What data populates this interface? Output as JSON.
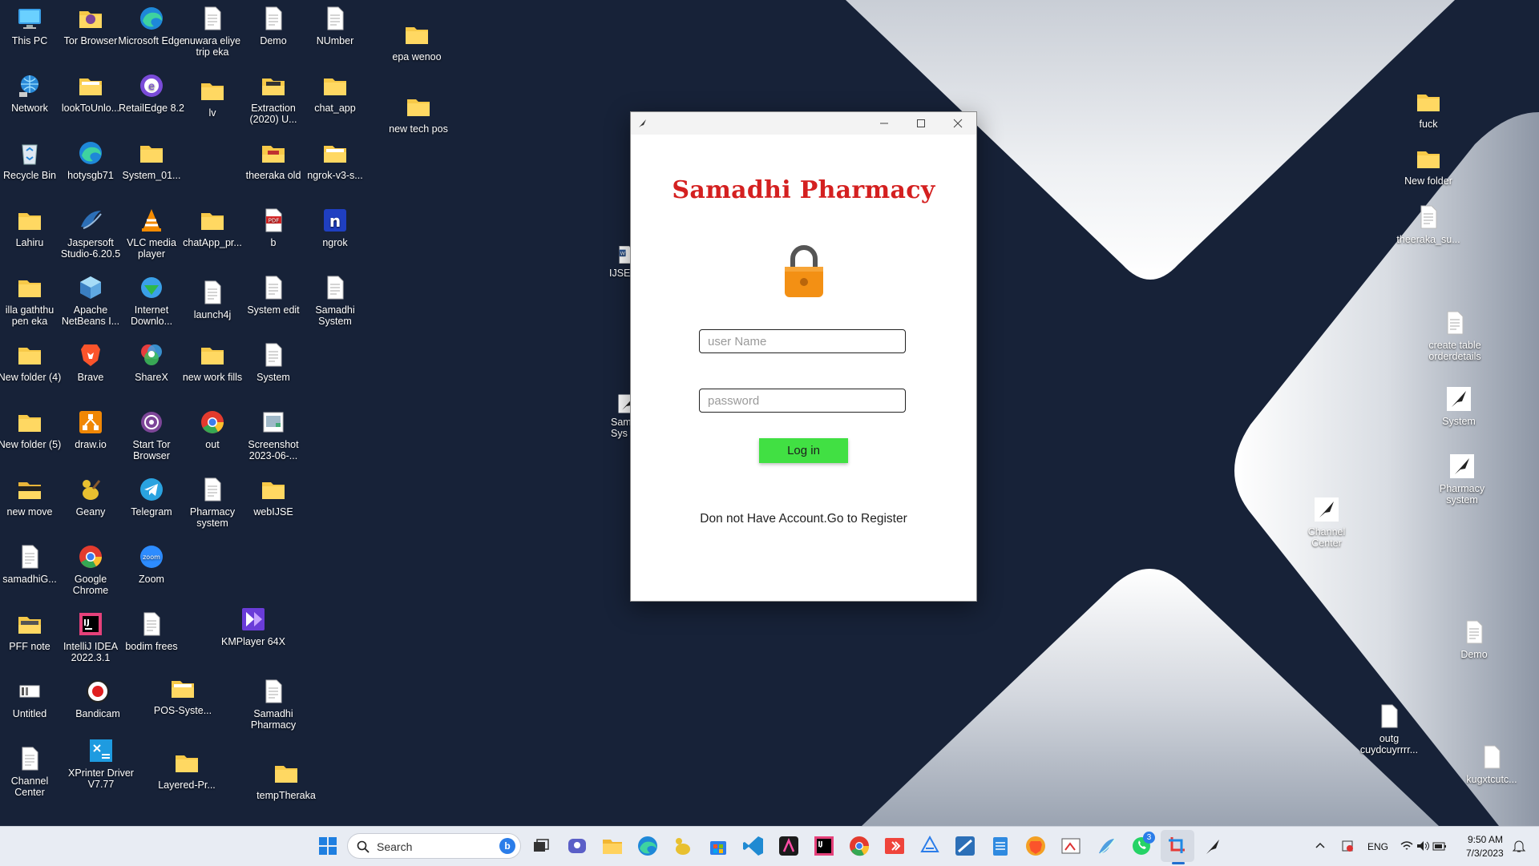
{
  "desktop": {
    "icons_col1": [
      {
        "label": "This PC",
        "icon": "computer-icon"
      },
      {
        "label": "Network",
        "icon": "network-icon"
      },
      {
        "label": "Recycle Bin",
        "icon": "recycle-bin-icon"
      },
      {
        "label": "Lahiru",
        "icon": "folder-icon"
      },
      {
        "label": "illa gaththu pen eka",
        "icon": "folder-icon"
      },
      {
        "label": "New folder (4)",
        "icon": "folder-icon"
      },
      {
        "label": "New folder (5)",
        "icon": "folder-icon"
      },
      {
        "label": "new move",
        "icon": "folder-icon"
      },
      {
        "label": "samadhiG...",
        "icon": "file-icon"
      },
      {
        "label": "PFF note",
        "icon": "folder-icon"
      },
      {
        "label": "Untitled",
        "icon": "image-icon"
      },
      {
        "label": "Channel Center",
        "icon": "file-icon"
      }
    ],
    "icons_col2": [
      {
        "label": "Tor Browser",
        "icon": "folder-icon"
      },
      {
        "label": "lookToUnlo...",
        "icon": "folder-icon"
      },
      {
        "label": "hotysgb71",
        "icon": "edge-icon"
      },
      {
        "label": "Jaspersoft Studio-6.20.5",
        "icon": "jaspersoft-icon"
      },
      {
        "label": "Apache NetBeans I...",
        "icon": "netbeans-icon"
      },
      {
        "label": "Brave",
        "icon": "brave-icon"
      },
      {
        "label": "draw.io",
        "icon": "drawio-icon"
      },
      {
        "label": "Geany",
        "icon": "geany-icon"
      },
      {
        "label": "Google Chrome",
        "icon": "chrome-icon"
      },
      {
        "label": "IntelliJ IDEA 2022.3.1",
        "icon": "intellij-icon"
      },
      {
        "label": "Bandicam",
        "icon": "bandicam-icon"
      },
      {
        "label": "XPrinter Driver V7.77",
        "icon": "xprinter-icon"
      }
    ],
    "icons_col3": [
      {
        "label": "Microsoft Edge",
        "icon": "edge-icon"
      },
      {
        "label": "RetailEdge 8.2",
        "icon": "retailedge-icon"
      },
      {
        "label": "System_01...",
        "icon": "folder-icon"
      },
      {
        "label": "VLC media player",
        "icon": "vlc-icon"
      },
      {
        "label": "Internet Downlo...",
        "icon": "idm-icon"
      },
      {
        "label": "ShareX",
        "icon": "sharex-icon"
      },
      {
        "label": "Start Tor Browser",
        "icon": "tor-icon"
      },
      {
        "label": "Telegram",
        "icon": "telegram-icon"
      },
      {
        "label": "Zoom",
        "icon": "zoom-icon"
      },
      {
        "label": "bodim frees",
        "icon": "file-icon"
      },
      {
        "label": "POS-Syste...",
        "icon": "folder-icon"
      },
      {
        "label": "Layered-Pr...",
        "icon": "folder-icon"
      }
    ],
    "icons_col4": [
      {
        "label": "nuwara eliye trip eka",
        "icon": "file-icon"
      },
      {
        "label": "lv",
        "icon": "folder-icon"
      },
      {
        "label": "chatApp_pr...",
        "icon": "folder-icon"
      },
      {
        "label": "launch4j",
        "icon": "file-icon"
      },
      {
        "label": "new work fills",
        "icon": "folder-icon"
      },
      {
        "label": "out",
        "icon": "chrome-icon"
      },
      {
        "label": "Pharmacy system",
        "icon": "file-icon"
      },
      {
        "label": "KMPlayer 64X",
        "icon": "kmplayer-icon"
      }
    ],
    "icons_col5": [
      {
        "label": "Demo",
        "icon": "file-icon"
      },
      {
        "label": "Extraction (2020) U...",
        "icon": "folder-icon"
      },
      {
        "label": "theeraka old",
        "icon": "folder-icon"
      },
      {
        "label": "b",
        "icon": "pdf-icon"
      },
      {
        "label": "System edit",
        "icon": "file-icon"
      },
      {
        "label": "System",
        "icon": "file-icon"
      },
      {
        "label": "Screenshot 2023-06-...",
        "icon": "image-icon"
      },
      {
        "label": "webIJSE",
        "icon": "folder-icon"
      },
      {
        "label": "Samadhi Pharmacy",
        "icon": "file-icon"
      },
      {
        "label": "tempTheraka",
        "icon": "folder-icon"
      }
    ],
    "icons_col6": [
      {
        "label": "NUmber",
        "icon": "file-icon"
      },
      {
        "label": "chat_app",
        "icon": "folder-icon"
      },
      {
        "label": "ngrok-v3-s...",
        "icon": "folder-icon"
      },
      {
        "label": "ngrok",
        "icon": "ngrok-icon"
      },
      {
        "label": "Samadhi System",
        "icon": "file-icon"
      }
    ],
    "icons_col7": [
      {
        "label": "epa wenoo",
        "icon": "folder-icon"
      },
      {
        "label": "new tech pos",
        "icon": "folder-icon"
      }
    ],
    "icons_partial": [
      {
        "label": "IJSE S",
        "icon": "word-icon"
      },
      {
        "label": "Sam Sys",
        "icon": "java-app-icon"
      }
    ],
    "icons_right": [
      {
        "label": "fuck",
        "icon": "folder-icon"
      },
      {
        "label": "New folder",
        "icon": "folder-icon"
      },
      {
        "label": "theeraka_su...",
        "icon": "file-icon"
      },
      {
        "label": "create table orderdetails",
        "icon": "file-icon"
      },
      {
        "label": "System",
        "icon": "java-app-icon"
      },
      {
        "label": "Pharmacy system",
        "icon": "java-app-icon"
      },
      {
        "label": "Channel Center",
        "icon": "java-app-icon"
      },
      {
        "label": "Demo",
        "icon": "file-icon"
      },
      {
        "label": "outg cuydcuyrrrr...",
        "icon": "file-icon"
      },
      {
        "label": "kugxtcutc...",
        "icon": "file-icon"
      }
    ]
  },
  "login_window": {
    "title_icon": "java-feather-icon",
    "app_title": "Samadhi Pharmacy",
    "lock_icon": "padlock-icon",
    "username_placeholder": "user Name",
    "password_placeholder": "password",
    "login_label": "Log in",
    "register_text": "Don not Have Account.Go to Register",
    "colors": {
      "title": "#d42020",
      "login_button": "#41e043",
      "lock": "#f39014"
    }
  },
  "taskbar": {
    "search_placeholder": "Search",
    "apps": [
      "windows-start-icon",
      "task-view-icon",
      "teams-icon",
      "file-explorer-icon",
      "edge-icon",
      "geany-icon",
      "microsoft-store-icon",
      "vscode-icon",
      "affinity-icon",
      "intellij-icon",
      "chrome-icon",
      "anydesk-icon",
      "word-icon",
      "jaspersoft-icon",
      "notepad-icon",
      "brave-icon",
      "snipping-icon",
      "netbeans-icon",
      "whatsapp-icon",
      "snip-sketch-icon",
      "java-feather-icon"
    ],
    "whatsapp_badge": "3",
    "tray": {
      "language": "ENG",
      "time": "9:50 AM",
      "date": "7/3/2023"
    }
  }
}
